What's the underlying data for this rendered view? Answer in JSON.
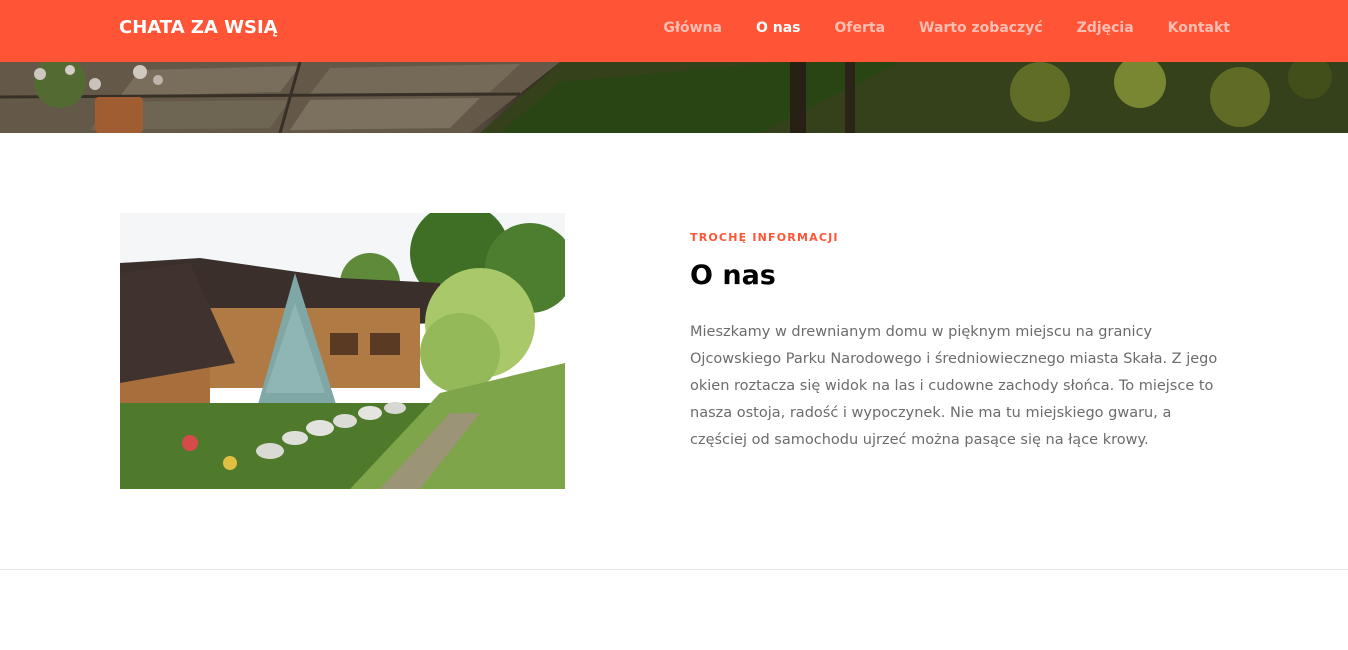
{
  "navbar": {
    "brand": "CHATA ZA WSIĄ",
    "items": [
      {
        "label": "Główna",
        "active": false
      },
      {
        "label": "O nas",
        "active": true
      },
      {
        "label": "Oferta",
        "active": false
      },
      {
        "label": "Warto zobaczyć",
        "active": false
      },
      {
        "label": "Zdjęcia",
        "active": false
      },
      {
        "label": "Kontakt",
        "active": false
      }
    ]
  },
  "about": {
    "subtitle": "TROCHĘ INFORMACJI",
    "title": "O nas",
    "text": "Mieszkamy w drewnianym domu w pięknym miejscu na granicy Ojcowskiego Parku Narodowego i średniowiecznego miasta Skała. Z jego okien roztacza się widok na las i cudowne zachody słońca. To miejsce to nasza ostoja, radość i wypoczynek. Nie ma tu miejskiego gwaru, a częściej od samochodu ujrzeć można pasące się na łące krowy."
  },
  "colors": {
    "accent": "#ff5435",
    "text_muted": "#6c6c6c"
  }
}
